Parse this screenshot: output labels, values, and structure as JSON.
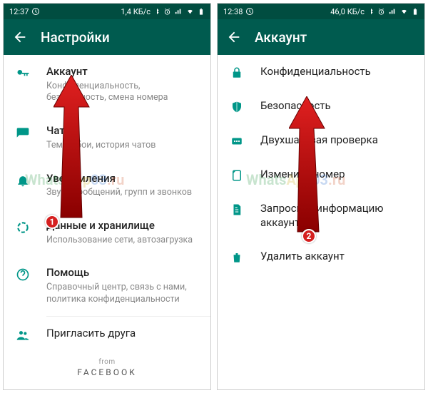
{
  "left": {
    "status": {
      "time": "12:37",
      "speed": "1,4 КБ/с"
    },
    "title": "Настройки",
    "items": [
      {
        "icon": "key",
        "label": "Аккаунт",
        "sub": "Конфиденциальность, безопасность, смена номера"
      },
      {
        "icon": "chat",
        "label": "Чаты",
        "sub": "Тема, обои, история чатов"
      },
      {
        "icon": "bell",
        "label": "Уведомления",
        "sub": "Звуки сообщений, групп и звонков"
      },
      {
        "icon": "data",
        "label": "Данные и хранилище",
        "sub": "Использование сети, автозагрузка"
      },
      {
        "icon": "help",
        "label": "Помощь",
        "sub": "Справочный центр, связь с нами, политика конфиденциальности"
      },
      {
        "icon": "people",
        "label": "Пригласить друга",
        "sub": ""
      }
    ],
    "from": "from",
    "brand": "FACEBOOK",
    "badge": "1"
  },
  "right": {
    "status": {
      "time": "12:38",
      "speed": "46,0 КБ/с"
    },
    "title": "Аккаунт",
    "items": [
      {
        "icon": "lock",
        "label": "Конфиденциальность"
      },
      {
        "icon": "shield",
        "label": "Безопасность"
      },
      {
        "icon": "twostep",
        "label": "Двухшаговая проверка"
      },
      {
        "icon": "sim",
        "label": "Изменить номер"
      },
      {
        "icon": "doc",
        "label": "Запросить информацию аккаунта"
      },
      {
        "icon": "trash",
        "label": "Удалить аккаунт"
      }
    ],
    "badge": "2"
  },
  "watermark": "WhatsApp03.ru"
}
